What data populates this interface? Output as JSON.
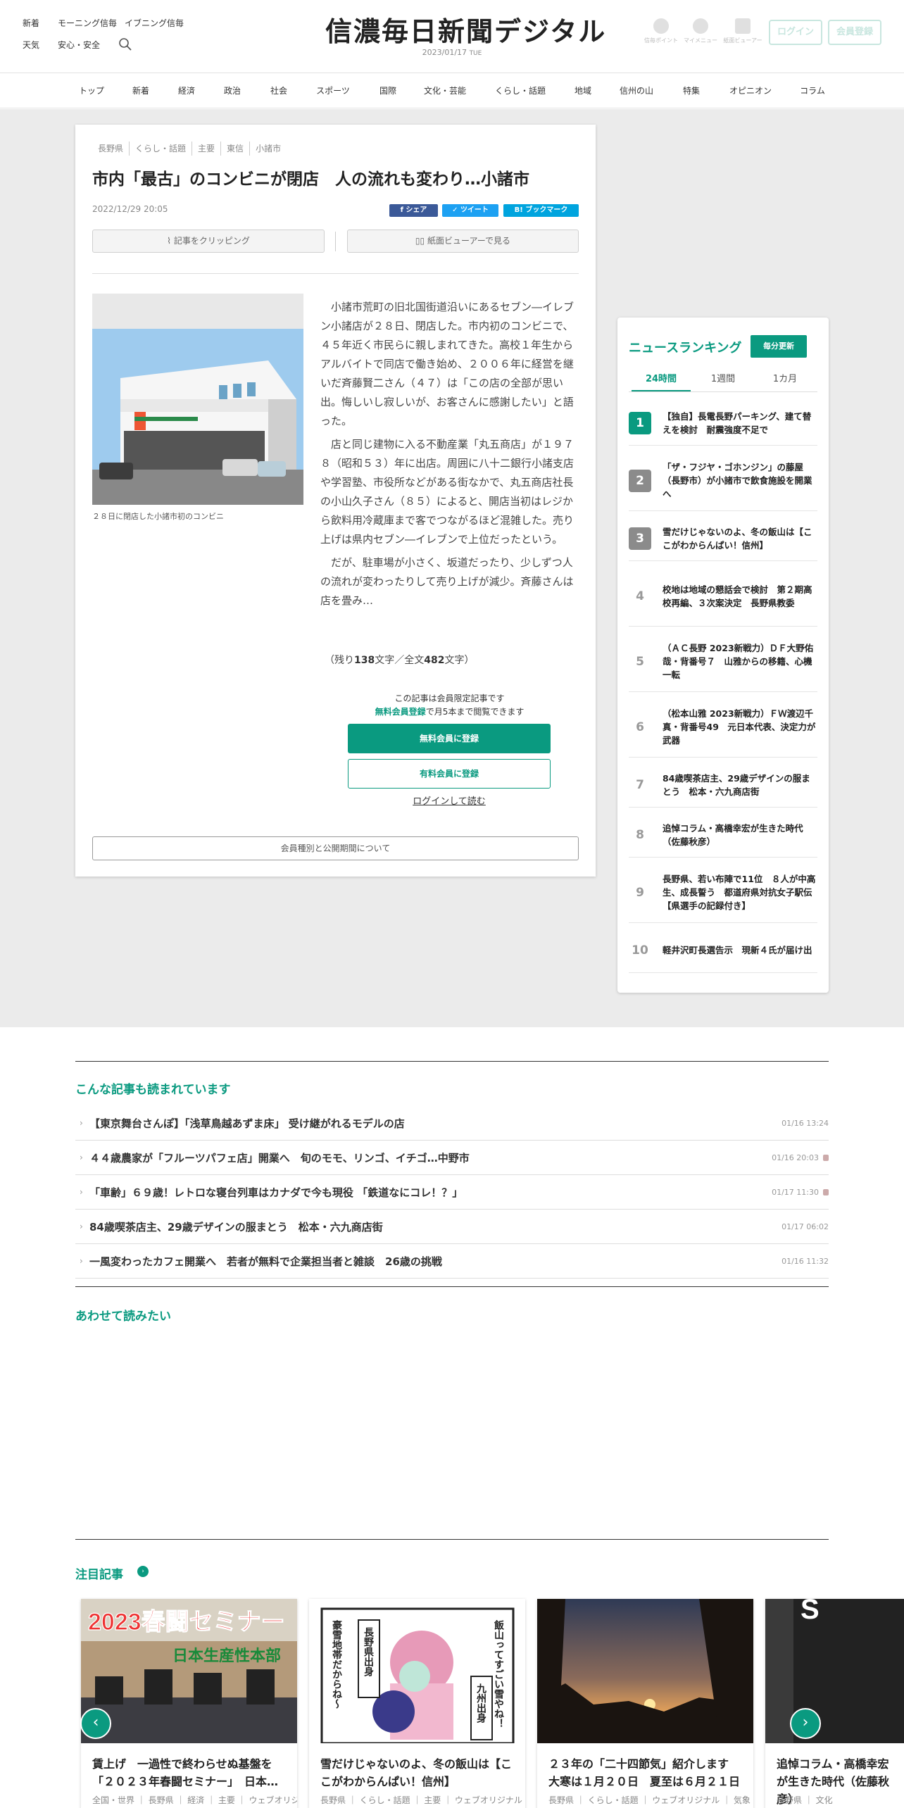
{
  "header": {
    "links_row1": [
      "新着",
      "モーニング信毎",
      "イブニング信毎"
    ],
    "links_row2": [
      "天気",
      "安心・安全"
    ],
    "logo": "信濃毎日新聞デジタル",
    "date": "2023/01/17",
    "weekday": "TUE",
    "icons": [
      "信毎ポイント",
      "マイメニュー",
      "紙面ビューアー"
    ],
    "login_label": "ログイン",
    "register_label": "会員登録"
  },
  "nav": [
    "トップ",
    "新着",
    "経済",
    "政治",
    "社会",
    "スポーツ",
    "国際",
    "文化・芸能",
    "くらし・話題",
    "地域",
    "信州の山",
    "特集",
    "オピニオン",
    "コラム"
  ],
  "article": {
    "tags": [
      "長野県",
      "くらし・話題",
      "主要",
      "東信",
      "小諸市"
    ],
    "title": "市内「最古」のコンビニが閉店　人の流れも変わり…小諸市",
    "date": "2022/12/29 20:05",
    "share": "シェア",
    "tweet": "ツイート",
    "bookmark": "ブックマーク",
    "clip_label": "記事をクリッピング",
    "viewer_label": "紙面ビューアーで見る",
    "caption": "２８日に閉店した小諸市初のコンビニ",
    "paragraphs": [
      "小諸市荒町の旧北国街道沿いにあるセブン―イレブン小諸店が２８日、閉店した。市内初のコンビニで、４５年近く市民らに親しまれてきた。高校１年生からアルバイトで同店で働き始め、２００６年に経営を継いだ斉藤賢二さん（４７）は「この店の全部が思い出。悔しいし寂しいが、お客さんに感謝したい」と語った。",
      "店と同じ建物に入る不動産業「丸五商店」が１９７８（昭和５３）年に出店。周囲に八十二銀行小諸支店や学習塾、市役所などがある街なかで、丸五商店社長の小山久子さん（８５）によると、開店当初はレジから飲料用冷蔵庫まで客でつながるほど混雑した。売り上げは県内セブン―イレブンで上位だったという。",
      "だが、駐車場が小さく、坂道だったり、少しずつ人の流れが変わったりして売り上げが減少。斉藤さんは店を畳み…"
    ],
    "remain_prefix": "（残り",
    "remain_chars": "138",
    "remain_mid": "文字／全文",
    "total_chars": "482",
    "remain_suffix": "文字）",
    "member_note": "この記事は会員限定記事です",
    "free_note_link": "無料会員登録",
    "free_note_rest": "で月5本まで閲覧できます",
    "free_btn": "無料会員に登録",
    "paid_btn": "有料会員に登録",
    "login_read": "ログインして読む",
    "member_types": "会員種別と公開期間について"
  },
  "ranking": {
    "title": "ニュースランキング",
    "update": "毎分更新",
    "tabs": [
      "24時間",
      "1週間",
      "1カ月"
    ],
    "items": [
      {
        "n": "1",
        "t": "【独自】長電長野パーキング、建て替えを検討　耐震強度不足で"
      },
      {
        "n": "2",
        "t": "「ザ・フジヤ・ゴホンジン」の藤屋（長野市）が小諸市で飲食施設を開業へ"
      },
      {
        "n": "3",
        "t": "雪だけじゃないのよ、冬の飯山は【ここがわからんぱい！信州】"
      },
      {
        "n": "4",
        "t": "校地は地域の懇話会で検討　第２期高校再編、３次案決定　長野県教委"
      },
      {
        "n": "5",
        "t": "（ＡＣ長野 2023新戦力）ＤＦ大野佑哉・背番号７　山雅からの移籍、心機一転"
      },
      {
        "n": "6",
        "t": "（松本山雅 2023新戦力）ＦＷ渡辺千真・背番号49　元日本代表、決定力が武器"
      },
      {
        "n": "7",
        "t": "84歳喫茶店主、29歳デザインの服まとう　松本・六九商店街"
      },
      {
        "n": "8",
        "t": "追悼コラム・高橋幸宏が生きた時代（佐藤秋彦）"
      },
      {
        "n": "9",
        "t": "長野県、若い布陣で11位　８人が中高生、成長誓う　都道府県対抗女子駅伝　【県選手の記録付き】"
      },
      {
        "n": "10",
        "t": "軽井沢町長選告示　現新４氏が届け出"
      }
    ]
  },
  "also_read": {
    "title": "こんな記事も読まれています",
    "items": [
      {
        "t": "【東京舞台さんぽ】「浅草鳥越あずま床」 受け継がれるモデルの店",
        "d": "01/16 13:24"
      },
      {
        "t": "４４歳農家が「フルーツパフェ店」開業へ　旬のモモ、リンゴ、イチゴ…中野市",
        "d": "01/16 20:03"
      },
      {
        "t": "「車齢」６９歳！レトロな寝台列車はカナダで今も現役 「鉄道なにコレ！？」",
        "d": "01/17 11:30"
      },
      {
        "t": "84歳喫茶店主、29歳デザインの服まとう　松本・六九商店街",
        "d": "01/17 06:02"
      },
      {
        "t": "一風変わったカフェ開業へ　若者が無料で企業担当者と雑談　26歳の挑戦",
        "d": "01/16 11:32"
      }
    ]
  },
  "together": {
    "title": "あわせて読みたい"
  },
  "featured": {
    "title": "注目記事",
    "cards": [
      {
        "t": "賃上げ　一過性で終わらせぬ基盤を「２０２３年春闘セミナー」　日本…",
        "m": "全国・世界 ｜ 長野県 ｜ 経済 ｜ 主要 ｜ ウェブオリジ",
        "banner": "2023春闘セミナー",
        "sub": "日本生産性本部"
      },
      {
        "t": "雪だけじゃないのよ、冬の飯山は【ここがわからんぱい！信州】",
        "m": "長野県 ｜ くらし・話題 ｜ 主要 ｜ ウェブオリジナル",
        "b1": "豪雪地帯だからね〜",
        "b2": "長野県出身",
        "b3": "九州出身",
        "b4": "飯山ってすごい雪やね！"
      },
      {
        "t": "２３年の「二十四節気」紹介します　大寒は１月２０日　夏至は６月２１日",
        "m": "長野県 ｜ くらし・話題 ｜ ウェブオリジナル ｜ 気象"
      },
      {
        "t": "追悼コラム・高橋幸宏が生きた時代（佐藤秋彦）",
        "m": "長野県 ｜ 文化"
      }
    ]
  },
  "colors": {
    "accent": "#0a9a80",
    "facebook": "#3b5998",
    "twitter": "#1da1f2",
    "hatena": "#00a4de"
  }
}
